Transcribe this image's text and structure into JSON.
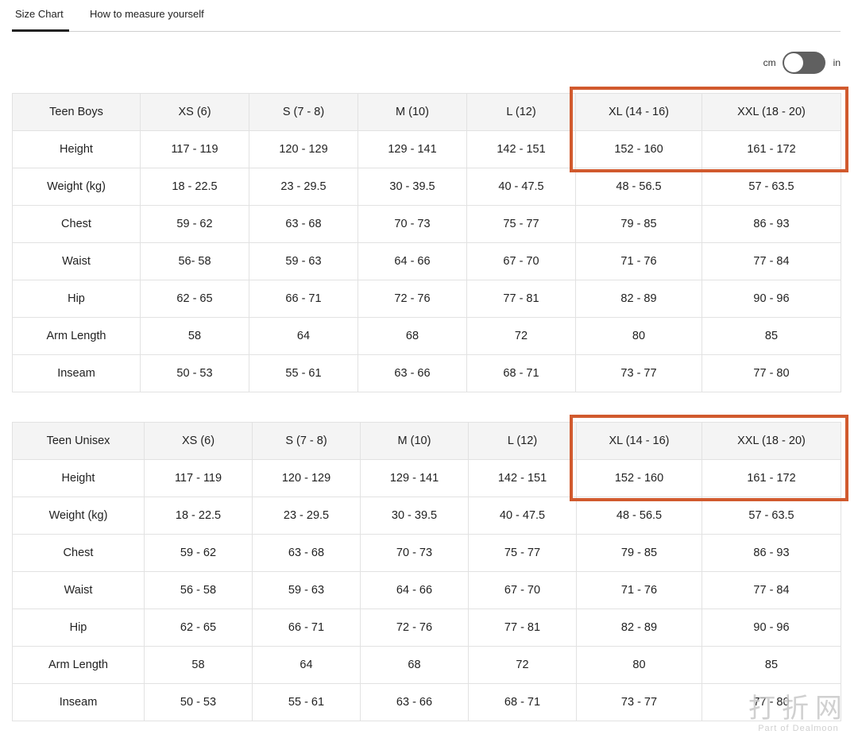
{
  "tabs": {
    "size_chart": "Size Chart",
    "how_to_measure": "How to measure yourself"
  },
  "unit_toggle": {
    "left_label": "cm",
    "right_label": "in"
  },
  "tables": [
    {
      "title": "Teen Boys",
      "sizes": [
        "XS (6)",
        "S (7 - 8)",
        "M (10)",
        "L (12)",
        "XL (14 - 16)",
        "XXL (18 - 20)"
      ],
      "rows": [
        {
          "label": "Height",
          "values": [
            "117 - 119",
            "120 - 129",
            "129 - 141",
            "142 - 151",
            "152 - 160",
            "161 - 172"
          ]
        },
        {
          "label": "Weight (kg)",
          "values": [
            "18 - 22.5",
            "23 - 29.5",
            "30 - 39.5",
            "40 - 47.5",
            "48 - 56.5",
            "57 - 63.5"
          ]
        },
        {
          "label": "Chest",
          "values": [
            "59 - 62",
            "63 - 68",
            "70 - 73",
            "75 - 77",
            "79 - 85",
            "86 - 93"
          ]
        },
        {
          "label": "Waist",
          "values": [
            "56- 58",
            "59 - 63",
            "64 - 66",
            "67 - 70",
            "71 - 76",
            "77 - 84"
          ]
        },
        {
          "label": "Hip",
          "values": [
            "62 - 65",
            "66 - 71",
            "72 - 76",
            "77 - 81",
            "82 - 89",
            "90 - 96"
          ]
        },
        {
          "label": "Arm Length",
          "values": [
            "58",
            "64",
            "68",
            "72",
            "80",
            "85"
          ]
        },
        {
          "label": "Inseam",
          "values": [
            "50 - 53",
            "55 - 61",
            "63 - 66",
            "68 - 71",
            "73 - 77",
            "77 - 80"
          ]
        }
      ]
    },
    {
      "title": "Teen Unisex",
      "sizes": [
        "XS (6)",
        "S (7 - 8)",
        "M (10)",
        "L (12)",
        "XL (14 - 16)",
        "XXL (18 - 20)"
      ],
      "rows": [
        {
          "label": "Height",
          "values": [
            "117 - 119",
            "120 - 129",
            "129 - 141",
            "142 - 151",
            "152 - 160",
            "161 - 172"
          ]
        },
        {
          "label": "Weight (kg)",
          "values": [
            "18 - 22.5",
            "23 - 29.5",
            "30 - 39.5",
            "40 - 47.5",
            "48 - 56.5",
            "57 - 63.5"
          ]
        },
        {
          "label": "Chest",
          "values": [
            "59 - 62",
            "63 - 68",
            "70 - 73",
            "75 - 77",
            "79 - 85",
            "86 - 93"
          ]
        },
        {
          "label": "Waist",
          "values": [
            "56 - 58",
            "59 - 63",
            "64 - 66",
            "67 - 70",
            "71 - 76",
            "77 - 84"
          ]
        },
        {
          "label": "Hip",
          "values": [
            "62 - 65",
            "66 - 71",
            "72 - 76",
            "77 - 81",
            "82 - 89",
            "90 - 96"
          ]
        },
        {
          "label": "Arm Length",
          "values": [
            "58",
            "64",
            "68",
            "72",
            "80",
            "85"
          ]
        },
        {
          "label": "Inseam",
          "values": [
            "50 - 53",
            "55 - 61",
            "63 - 66",
            "68 - 71",
            "73 - 77",
            "77 - 80"
          ]
        }
      ]
    }
  ],
  "highlight_color": "#d15a2e",
  "watermark": {
    "main": "打折网",
    "sub": "Part of Dealmoon"
  }
}
